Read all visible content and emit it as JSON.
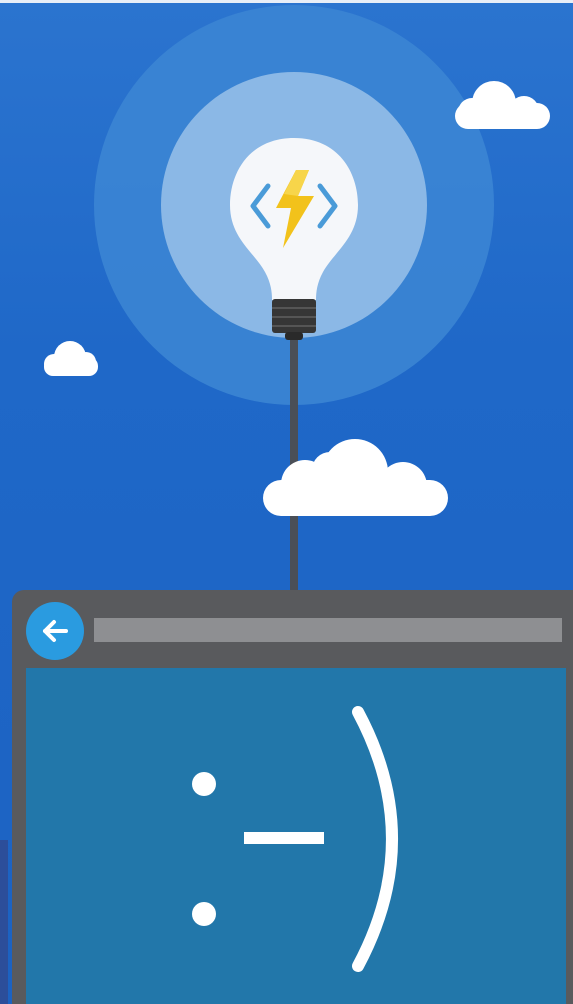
{
  "scene": {
    "sky_color": "#1f68c8",
    "cloud_color": "#ffffff",
    "halo_outer_color": "#3d86d4",
    "halo_inner_color": "#8bb8e6",
    "bulb_color": "#f5f7fa",
    "bulb_base_color": "#3a3a3a",
    "cord_color": "#4a4f57",
    "logo_icon": "azure-functions-icon",
    "logo_bolt_color": "#f2c21b",
    "logo_bracket_color": "#4a9bd8"
  },
  "browser": {
    "frame_color": "#595a5d",
    "back_icon": "back-arrow-icon",
    "back_button_color": "#2a9be0",
    "address_bar_color": "#8e8f92",
    "address_text": "",
    "content_color": "#2277aa",
    "emoticon": ":-)"
  }
}
